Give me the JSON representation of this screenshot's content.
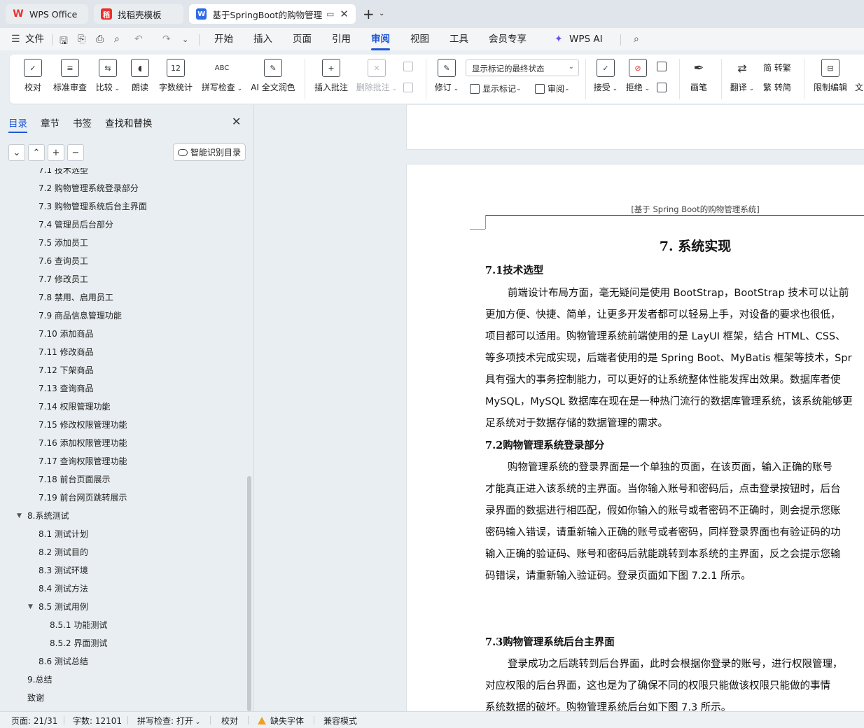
{
  "tabs": {
    "wps": "WPS Office",
    "template": "找稻壳模板",
    "doc": "基于SpringBoot的购物管理系统"
  },
  "menu": {
    "file": "文件",
    "items": [
      "开始",
      "插入",
      "页面",
      "引用",
      "审阅",
      "视图",
      "工具",
      "会员专享"
    ],
    "active": "审阅",
    "ai": "WPS AI"
  },
  "ribbon": {
    "proof": "校对",
    "standard_review": "标准审查",
    "compare": "比较",
    "read_aloud": "朗读",
    "word_count": "字数统计",
    "spell_check": "拼写检查",
    "ai_polish": "AI 全文润色",
    "insert_comment": "插入批注",
    "delete_comment": "删除批注",
    "revise": "修订",
    "markup_state": "显示标记的最终状态",
    "show_markup": "显示标记",
    "review_pane": "审阅",
    "accept": "接受",
    "reject": "拒绝",
    "ink": "画笔",
    "translate": "翻译",
    "to_traditional": "简 转繁",
    "to_simplified": "繁 转简",
    "restrict_edit": "限制编辑",
    "more": "文"
  },
  "sidebar": {
    "tabs": [
      "目录",
      "章节",
      "书签",
      "查找和替换"
    ],
    "smart_toc": "智能识别目录",
    "toc": [
      {
        "text": "7.1 技术选型",
        "level": 2
      },
      {
        "text": "7.2 购物管理系统登录部分",
        "level": 2
      },
      {
        "text": "7.3 购物管理系统后台主界面",
        "level": 2
      },
      {
        "text": "7.4 管理员后台部分",
        "level": 2
      },
      {
        "text": "7.5 添加员工",
        "level": 2
      },
      {
        "text": "7.6 查询员工",
        "level": 2
      },
      {
        "text": "7.7 修改员工",
        "level": 2
      },
      {
        "text": "7.8 禁用、启用员工",
        "level": 2
      },
      {
        "text": "7.9 商品信息管理功能",
        "level": 2
      },
      {
        "text": "7.10 添加商品",
        "level": 2
      },
      {
        "text": "7.11 修改商品",
        "level": 2
      },
      {
        "text": "7.12 下架商品",
        "level": 2
      },
      {
        "text": "7.13 查询商品",
        "level": 2
      },
      {
        "text": "7.14 权限管理功能",
        "level": 2
      },
      {
        "text": "7.15 修改权限管理功能",
        "level": 2
      },
      {
        "text": "7.16 添加权限管理功能",
        "level": 2
      },
      {
        "text": "7.17 查询权限管理功能",
        "level": 2
      },
      {
        "text": "7.18 前台页面展示",
        "level": 2
      },
      {
        "text": "7.19 前台网页跳转展示",
        "level": 2
      },
      {
        "text": "8.系统测试",
        "level": 1,
        "expanded": true
      },
      {
        "text": "8.1 测试计划",
        "level": 2
      },
      {
        "text": "8.2 测试目的",
        "level": 2
      },
      {
        "text": "8.3 测试环境",
        "level": 2
      },
      {
        "text": "8.4 测试方法",
        "level": 2
      },
      {
        "text": "8.5 测试用例",
        "level": 2,
        "expanded": true
      },
      {
        "text": "8.5.1 功能测试",
        "level": 3
      },
      {
        "text": "8.5.2 界面测试",
        "level": 3
      },
      {
        "text": "8.6 测试总结",
        "level": 2
      },
      {
        "text": "9.总结",
        "level": 1
      },
      {
        "text": "致谢",
        "level": 1
      }
    ]
  },
  "document": {
    "header": "[基于 Spring Boot的购物管理系统]",
    "chapter_title": "7. 系统实现",
    "sec1_title": "7.1技术选型",
    "sec1_lines": [
      "前端设计布局方面，毫无疑问是使用 BootStrap，BootStrap 技术可以让前",
      "更加方便、快捷、简单，让更多开发者都可以轻易上手，对设备的要求也很低，",
      "项目都可以适用。购物管理系统前端使用的是 LayUI 框架，结合 HTML、CSS、",
      "等多项技术完成实现，后端者使用的是 Spring Boot、MyBatis 框架等技术，Spr",
      "具有强大的事务控制能力，可以更好的让系统整体性能发挥出效果。数据库者使",
      "MySQL，MySQL 数据库在现在是一种热门流行的数据库管理系统，该系统能够更",
      "足系统对于数据存储的数据管理的需求。"
    ],
    "sec2_title": "7.2购物管理系统登录部分",
    "sec2_lines": [
      "购物管理系统的登录界面是一个单独的页面，在该页面，输入正确的账号",
      "才能真正进入该系统的主界面。当你输入账号和密码后，点击登录按钮时，后台",
      "录界面的数据进行相匹配，假如你输入的账号或者密码不正确时，则会提示您账",
      "密码输入错误，请重新输入正确的账号或者密码，同样登录界面也有验证码的功",
      "输入正确的验证码、账号和密码后就能跳转到本系统的主界面，反之会提示您输",
      "码错误，请重新输入验证码。登录页面如下图 7.2.1 所示。"
    ],
    "sec3_title": "7.3购物管理系统后台主界面",
    "sec3_lines": [
      "登录成功之后跳转到后台界面，此时会根据你登录的账号，进行权限管理，",
      "对应权限的后台界面，这也是为了确保不同的权限只能做该权限只能做的事情",
      "系统数据的破坏。购物管理系统后台如下图 7.3 所示。"
    ]
  },
  "status": {
    "page": "页面: 21/31",
    "words": "字数: 12101",
    "spell": "拼写检查: 打开",
    "proof": "校对",
    "missing_font": "缺失字体",
    "compat": "兼容模式"
  },
  "colors": {
    "accent": "#1f57d6",
    "wps_red": "#e8312f",
    "doc_blue": "#2d6be6"
  }
}
